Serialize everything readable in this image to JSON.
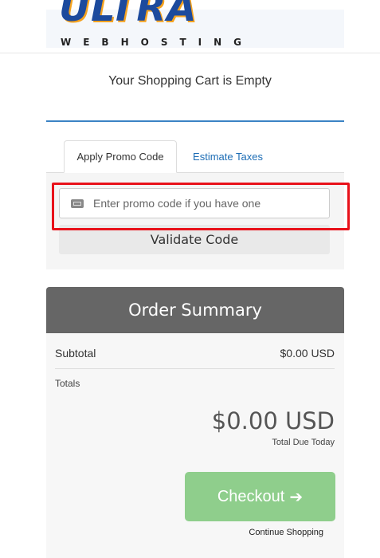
{
  "logo": {
    "main": "ULTRA",
    "sub": "WEBHOSTING"
  },
  "cart": {
    "empty_message": "Your Shopping Cart is Empty"
  },
  "promo": {
    "tabs": [
      {
        "label": "Apply Promo Code",
        "active": true
      },
      {
        "label": "Estimate Taxes",
        "active": false
      }
    ],
    "input_placeholder": "Enter promo code if you have one",
    "input_value": "",
    "validate_label": "Validate Code"
  },
  "summary": {
    "title": "Order Summary",
    "subtotal_label": "Subtotal",
    "subtotal_value": "$0.00 USD",
    "totals_label": "Totals",
    "total_amount": "$0.00 USD",
    "total_due_label": "Total Due Today",
    "checkout_label": "Checkout",
    "checkout_arrow": "➔",
    "continue_label": "Continue Shopping"
  },
  "colors": {
    "accent_blue": "#3b83c4",
    "checkout_green": "#8fce8c",
    "summary_header": "#666666",
    "highlight_red": "#e8111a"
  },
  "icons": {
    "promo_input": "ticket-icon",
    "checkout": "arrow-right-icon"
  }
}
